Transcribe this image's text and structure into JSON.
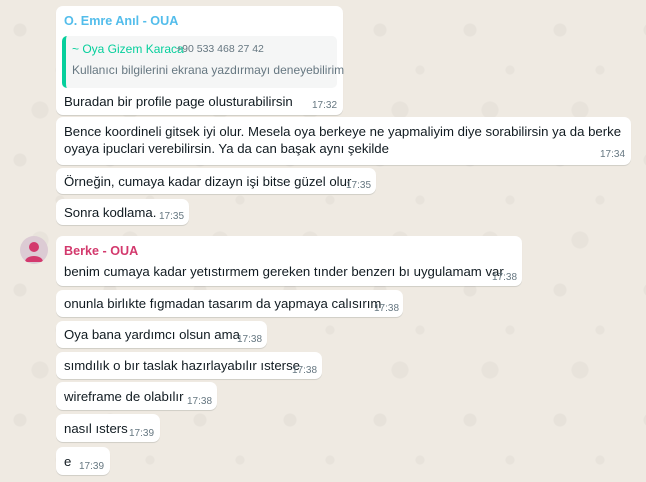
{
  "colors": {
    "chat_background": "#efeae2",
    "bubble": "#ffffff",
    "sender_emre": "#53bdeb",
    "sender_oya": "#06cf9c",
    "sender_berke": "#d3396d",
    "timestamp": "#667781"
  },
  "messages": [
    {
      "sender": "O. Emre Anıl - OUA",
      "quote": {
        "name": "~ Oya Gizem Karaca",
        "phone": "+90 533 468 27 42",
        "text": "Kullanıcı bilgilerini ekrana yazdırmayı deneyebilirim"
      },
      "text": "Buradan bir profile page olusturabilirsin",
      "time": "17:32"
    },
    {
      "line1": "Bence koordineli gitsek iyi olur. Mesela oya berkeye ne yapmaliyim diye sorabilirsin ya da berke",
      "line2": "oyaya ipuclari verebilirsin. Ya da can başak aynı şekilde",
      "time": "17:34"
    },
    {
      "text": "Örneğin, cumaya kadar dizayn işi bitse güzel olur",
      "time": "17:35"
    },
    {
      "text": "Sonra kodlama.",
      "time": "17:35"
    },
    {
      "sender": "Berke - OUA",
      "avatar_icon": "person-avatar-icon",
      "text": "benim cumaya kadar yetıstırmem gereken tınder benzerı bı uygulamam var",
      "time": "17:38"
    },
    {
      "text": "onunla birlıkte fıgmadan tasarım da yapmaya calısırım",
      "time": "17:38"
    },
    {
      "text": "Oya bana yardımcı olsun ama",
      "time": "17:38"
    },
    {
      "text": "sımdılık o bır taslak hazırlayabılır ısterse",
      "time": "17:38"
    },
    {
      "text": "wireframe de olabılır",
      "time": "17:38"
    },
    {
      "text": "nasıl ısters",
      "time": "17:39"
    },
    {
      "text": "e",
      "time": "17:39"
    }
  ]
}
